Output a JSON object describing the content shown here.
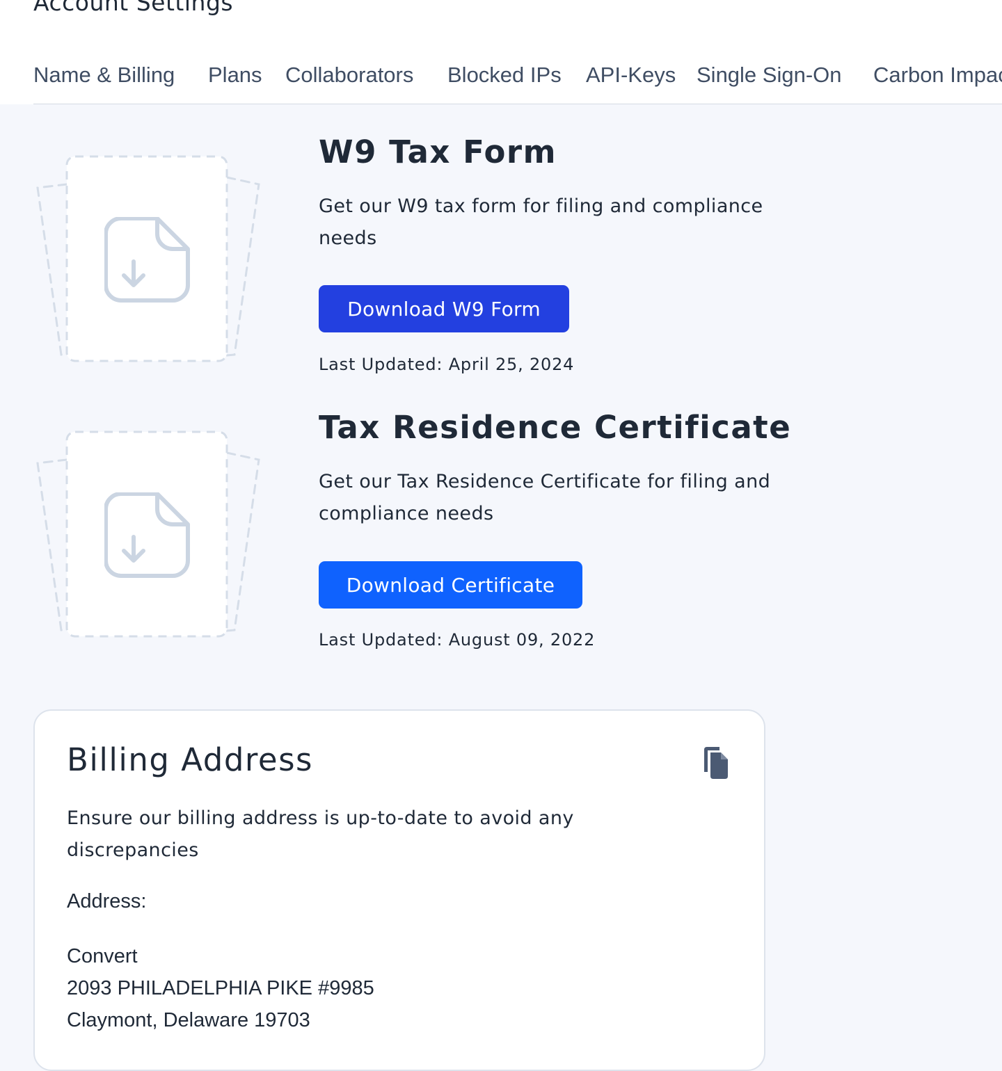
{
  "header": {
    "title": "Account Settings"
  },
  "tabs": [
    {
      "label": "Name & Billing"
    },
    {
      "label": "Plans"
    },
    {
      "label": "Collaborators"
    },
    {
      "label": "Blocked IPs"
    },
    {
      "label": "API-Keys"
    },
    {
      "label": "Single Sign-On"
    },
    {
      "label": "Carbon Impact"
    }
  ],
  "documents": [
    {
      "title": "W9 Tax Form",
      "description": "Get our W9 tax form for filing and compliance needs",
      "button_label": "Download W9 Form",
      "last_updated": "Last Updated: April 25, 2024",
      "icon": "file-download-icon"
    },
    {
      "title": "Tax Residence Certificate",
      "description": "Get our Tax Residence Certificate for filing and compliance needs",
      "button_label": "Download Certificate",
      "last_updated": "Last Updated: August 09, 2022",
      "icon": "file-download-icon"
    }
  ],
  "billing": {
    "title": "Billing Address",
    "description": "Ensure our billing address is up-to-date to avoid any discrepancies",
    "address_label": "Address:",
    "address_lines": [
      "Convert",
      "2093 PHILADELPHIA PIKE #9985",
      "Claymont, Delaware 19703"
    ],
    "copy_icon": "copy-icon"
  },
  "colors": {
    "page_background": "#f5f7fc",
    "w9_button": "#2340e0",
    "certificate_button": "#0f62fe",
    "text": "#1f2937",
    "tab_text": "#3f4d63",
    "placeholder_stroke": "#d5dde8",
    "file_icon_stroke": "#cbd5e2"
  }
}
